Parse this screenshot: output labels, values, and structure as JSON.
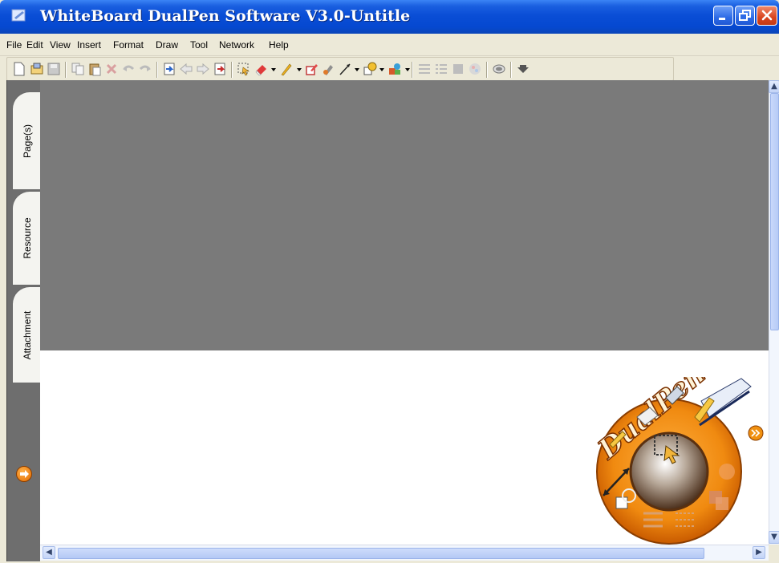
{
  "window": {
    "title": "WhiteBoard DualPen Software V3.0-Untitle"
  },
  "menu": [
    "File",
    "Edit",
    "View",
    "Insert",
    "Format",
    "Draw",
    "Tool",
    "Network",
    "Help"
  ],
  "toolbar": {
    "items": [
      "new-page-icon",
      "open-icon",
      "save-icon",
      "copy-icon",
      "paste-icon",
      "delete-icon",
      "undo-icon",
      "redo-icon",
      "import-icon",
      "previous-page-icon",
      "next-page-icon",
      "export-icon",
      "select-icon",
      "eraser-icon",
      "pen-icon",
      "marker-icon",
      "highlighter-icon",
      "line-icon",
      "shape-icon",
      "stamp-icon",
      "align-icon",
      "list-icon",
      "fill-icon",
      "color-icon",
      "mask-icon",
      "more-icon"
    ]
  },
  "sidebar": {
    "tabs": [
      "Page(s)",
      "Resource",
      "Attachment"
    ]
  },
  "logo": {
    "text": "DualPen"
  },
  "colors": {
    "titlebar": "#0548d0",
    "canvas_gray": "#7a7a7a",
    "canvas_white": "#ffffff",
    "panel": "#6e6e6e",
    "accent_orange": "#e36b00"
  }
}
